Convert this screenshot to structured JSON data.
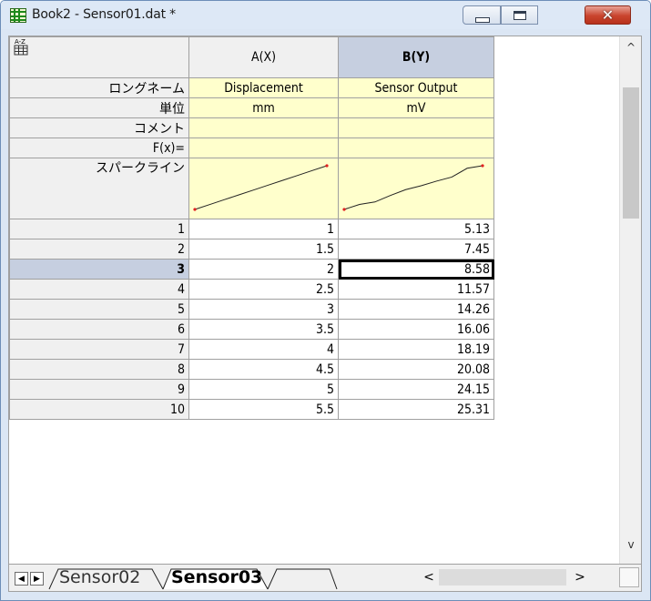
{
  "window": {
    "title": "Book2 - Sensor01.dat *",
    "close_glyph": "✕"
  },
  "sheet": {
    "corner_label": "A-Z",
    "columns": [
      {
        "header": "A(X)",
        "long_name": "Displacement",
        "units": "mm",
        "comment": "",
        "fx": ""
      },
      {
        "header": "B(Y)",
        "long_name": "Sensor Output",
        "units": "mV",
        "comment": "",
        "fx": ""
      }
    ],
    "row_labels": {
      "long_name": "ロングネーム",
      "units": "単位",
      "comment": "コメント",
      "fx": "F(x)=",
      "sparkline": "スパークライン"
    },
    "rows": [
      {
        "index": "1",
        "a": "1",
        "b": "5.13"
      },
      {
        "index": "2",
        "a": "1.5",
        "b": "7.45"
      },
      {
        "index": "3",
        "a": "2",
        "b": "8.58"
      },
      {
        "index": "4",
        "a": "2.5",
        "b": "11.57"
      },
      {
        "index": "5",
        "a": "3",
        "b": "14.26"
      },
      {
        "index": "6",
        "a": "3.5",
        "b": "16.06"
      },
      {
        "index": "7",
        "a": "4",
        "b": "18.19"
      },
      {
        "index": "8",
        "a": "4.5",
        "b": "20.08"
      },
      {
        "index": "9",
        "a": "5",
        "b": "24.15"
      },
      {
        "index": "10",
        "a": "5.5",
        "b": "25.31"
      }
    ],
    "selected_row": "3"
  },
  "tabs": [
    {
      "label": "Sensor02",
      "active": false
    },
    {
      "label": "Sensor03",
      "active": true
    }
  ],
  "scrollbar": {
    "up": "^",
    "down": "v",
    "left": "<",
    "right": ">"
  }
}
